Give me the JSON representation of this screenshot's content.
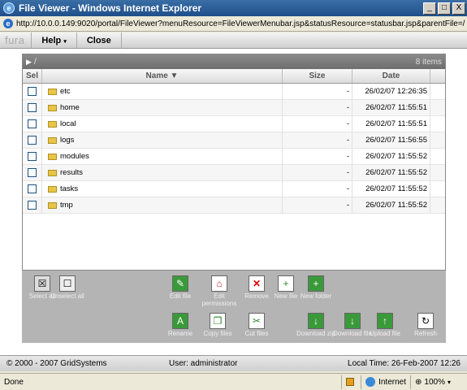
{
  "window": {
    "title": "File Viewer - Windows Internet Explorer",
    "min": "_",
    "max": "□",
    "close": "X"
  },
  "address": {
    "url": "http://10.0.0.149:9020/portal/FileViewer?menuResource=FileViewerMenubar.jsp&statusResource=statusbar.jsp&parentFile=/"
  },
  "menubar": {
    "logo": "fura",
    "help": "Help",
    "close": "Close"
  },
  "path": {
    "current": "/",
    "count": "8 items"
  },
  "table": {
    "headers": {
      "sel": "Sel",
      "name": "Name ▼",
      "size": "Size",
      "date": "Date"
    },
    "rows": [
      {
        "name": "etc",
        "size": "-",
        "date": "26/02/07 12:26:35"
      },
      {
        "name": "home",
        "size": "-",
        "date": "26/02/07 11:55:51"
      },
      {
        "name": "local",
        "size": "-",
        "date": "26/02/07 11:55:51"
      },
      {
        "name": "logs",
        "size": "-",
        "date": "26/02/07 11:56:55"
      },
      {
        "name": "modules",
        "size": "-",
        "date": "26/02/07 11:55:52"
      },
      {
        "name": "results",
        "size": "-",
        "date": "26/02/07 11:55:52"
      },
      {
        "name": "tasks",
        "size": "-",
        "date": "26/02/07 11:55:52"
      },
      {
        "name": "tmp",
        "size": "-",
        "date": "26/02/07 11:55:52"
      }
    ]
  },
  "toolbar": {
    "select_all": "Select all",
    "unselect_all": "Unselect all",
    "edit_file": "Edit file",
    "edit_permissions": "Edit permissions",
    "remove": "Remove",
    "new_file": "New file",
    "new_folder": "New folder",
    "rename": "Rename",
    "copy_files": "Copy files",
    "cut_files": "Cut files",
    "download_zip": "Download zip",
    "download_file": "Download file",
    "upload_file": "Upload file",
    "refresh": "Refresh"
  },
  "status": {
    "copyright": "© 2000 - 2007 GridSystems",
    "user": "User: administrator",
    "time": "Local Time: 26-Feb-2007 12:26"
  },
  "ie_status": {
    "done": "Done",
    "zone": "Internet",
    "zoom": "100%"
  }
}
